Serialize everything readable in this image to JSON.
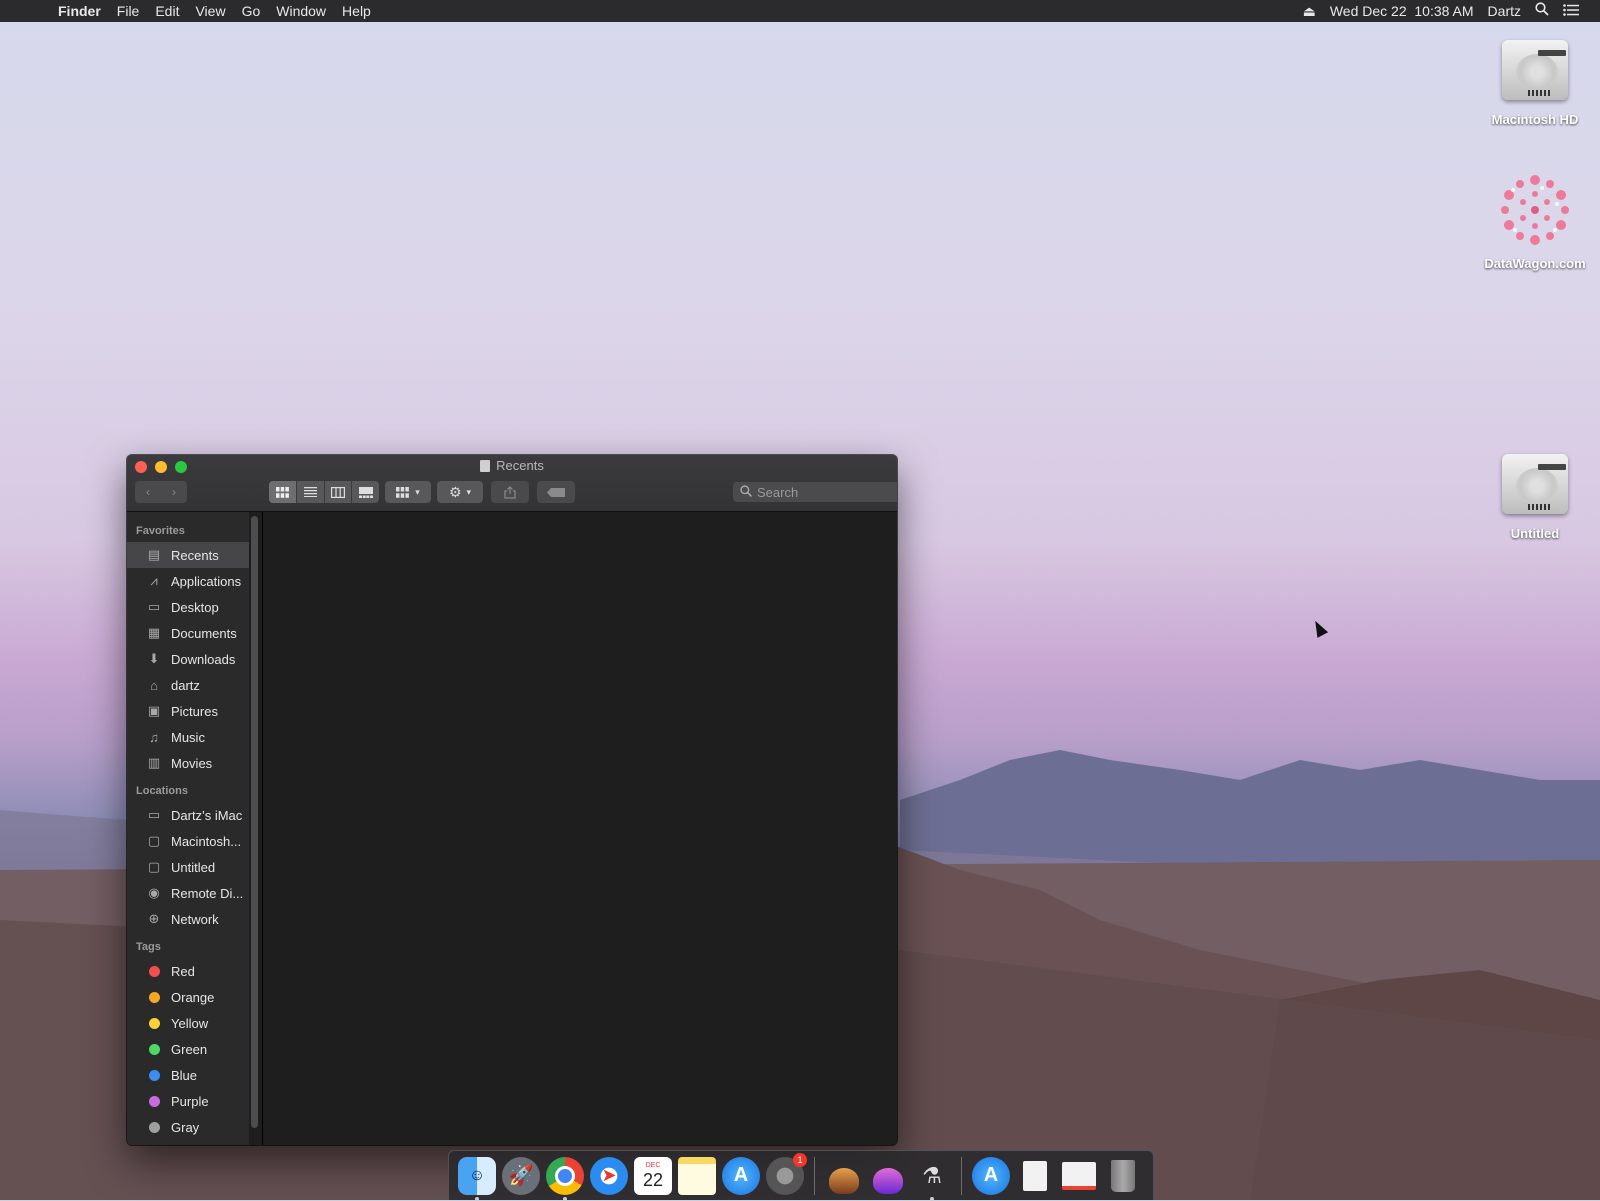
{
  "menubar": {
    "app_name": "Finder",
    "menus": [
      "File",
      "Edit",
      "View",
      "Go",
      "Window",
      "Help"
    ],
    "datetime": "Wed Dec 22  10:38 AM",
    "user": "Dartz",
    "icons": [
      "apple-icon",
      "eject-icon",
      "spotlight-icon",
      "notification-center-icon"
    ]
  },
  "desktop": {
    "icons": [
      {
        "label": "Macintosh HD",
        "icon": "hard-drive-icon"
      },
      {
        "label": "DataWagon.com",
        "icon": "flower-icon"
      },
      {
        "label": "Untitled",
        "icon": "hard-drive-icon"
      }
    ]
  },
  "finder": {
    "title": "Recents",
    "search_placeholder": "Search",
    "favorites_header": "Favorites",
    "favorites": [
      {
        "label": "Recents",
        "icon": "recents-icon",
        "selected": true
      },
      {
        "label": "Applications",
        "icon": "applications-icon"
      },
      {
        "label": "Desktop",
        "icon": "desktop-icon"
      },
      {
        "label": "Documents",
        "icon": "documents-icon"
      },
      {
        "label": "Downloads",
        "icon": "downloads-icon"
      },
      {
        "label": "dartz",
        "icon": "home-icon"
      },
      {
        "label": "Pictures",
        "icon": "pictures-icon"
      },
      {
        "label": "Music",
        "icon": "music-icon"
      },
      {
        "label": "Movies",
        "icon": "movies-icon"
      }
    ],
    "locations_header": "Locations",
    "locations": [
      {
        "label": "Dartz’s iMac",
        "icon": "imac-icon"
      },
      {
        "label": "Macintosh...",
        "icon": "disk-icon"
      },
      {
        "label": "Untitled",
        "icon": "disk-icon"
      },
      {
        "label": "Remote Di...",
        "icon": "remote-disc-icon"
      },
      {
        "label": "Network",
        "icon": "network-icon"
      }
    ],
    "tags_header": "Tags",
    "tags": [
      {
        "label": "Red",
        "color": "#f0504f"
      },
      {
        "label": "Orange",
        "color": "#f5a623"
      },
      {
        "label": "Yellow",
        "color": "#f8d33a"
      },
      {
        "label": "Green",
        "color": "#4cd964"
      },
      {
        "label": "Blue",
        "color": "#3b8ef0"
      },
      {
        "label": "Purple",
        "color": "#c66ce0"
      },
      {
        "label": "Gray",
        "color": "#a0a0a0"
      }
    ]
  },
  "dock": {
    "badge_count": "1",
    "calendar_month": "DEC",
    "calendar_day": "22",
    "apps": [
      "finder-icon",
      "launchpad-icon",
      "chrome-icon",
      "safari-icon",
      "calendar-icon",
      "notes-icon",
      "app-store-icon",
      "system-preferences-icon",
      "installer-icon",
      "installer-purple-icon",
      "usb-tool-icon",
      "app-store-folder-icon",
      "document-icon",
      "preview-doc-icon",
      "trash-icon"
    ]
  }
}
